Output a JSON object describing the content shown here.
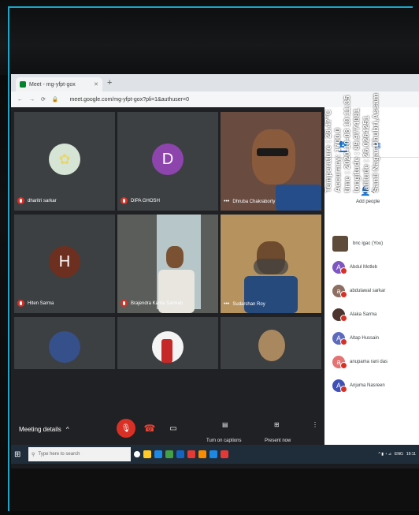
{
  "browser": {
    "tab_title": "Meet - mg-yfpt-gox",
    "url": "meet.google.com/mg-yfpt-gox?pli=1&authuser=0"
  },
  "tiles": [
    {
      "name": "dharitri sarkar",
      "avatar": "",
      "avatar_color": "#1f6f5c"
    },
    {
      "name": "DIPA GHOSH",
      "avatar": "D",
      "avatar_color": "#8e44ad"
    },
    {
      "name": "Dhruba Chakraborty",
      "avatar": "",
      "avatar_color": ""
    },
    {
      "name": "Hiten Sarma",
      "avatar": "H",
      "avatar_color": "#6d2f1f"
    },
    {
      "name": "Brajendra Kanta Sarmah",
      "avatar": "",
      "avatar_color": ""
    },
    {
      "name": "Sudarshan Roy",
      "avatar": "",
      "avatar_color": ""
    }
  ],
  "meetbar": {
    "details_label": "Meeting details",
    "captions_label": "Turn on captions",
    "present_label": "Present now"
  },
  "panel": {
    "add_people": "Add people",
    "people": [
      {
        "name": "bnc igac (You)",
        "initial": "",
        "color": "#5f4b3a"
      },
      {
        "name": "Abdul Motleb",
        "initial": "A",
        "color": "#7e57c2"
      },
      {
        "name": "abdulawal sarkar",
        "initial": "a",
        "color": "#8d6e63"
      },
      {
        "name": "Alaka Sarma",
        "initial": "",
        "color": "#4e342e"
      },
      {
        "name": "Altap Hussain",
        "initial": "A",
        "color": "#5c6bc0"
      },
      {
        "name": "anupama rani das",
        "initial": "a",
        "color": "#e57373"
      },
      {
        "name": "Anjuma Nasreen",
        "initial": "A",
        "color": "#3f51b5"
      }
    ]
  },
  "taskbar": {
    "search_placeholder": "Type here to search",
    "lang": "ENG",
    "time": "19:11"
  },
  "overlay": {
    "temperature": "Temperature : 28.47°C",
    "accuracy": "Accuracy: 1700.0",
    "time": "time : 2020-10-08 19:11:35",
    "longitude": "longitude : 89.9774081",
    "latitude": "latitude : 26.0264251",
    "address": "Santi Nagar,Dhubri,Assam"
  }
}
